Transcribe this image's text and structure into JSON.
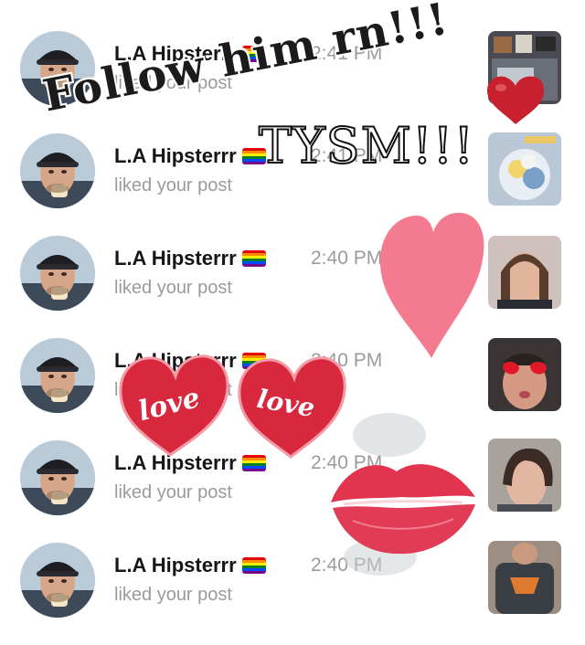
{
  "notifications": [
    {
      "user": "L.A Hipsterrr",
      "time": "2:41 PM",
      "action": "liked your post"
    },
    {
      "user": "L.A Hipsterrr",
      "time": "2:41 PM",
      "action": "liked your post"
    },
    {
      "user": "L.A Hipsterrr",
      "time": "2:40 PM",
      "action": "liked your post"
    },
    {
      "user": "L.A Hipsterrr",
      "time": "2:40 PM",
      "action": "liked your post"
    },
    {
      "user": "L.A Hipsterrr",
      "time": "2:40 PM",
      "action": "liked your post"
    },
    {
      "user": "L.A Hipsterrr",
      "time": "2:40 PM",
      "action": "liked your post"
    }
  ],
  "overlay": {
    "follow_text": "Follow him rn!!!",
    "tysm_text": "TYSM!!!",
    "love_left": "love",
    "love_right": "love"
  },
  "colors": {
    "heart_red": "#d8283e",
    "heart_pink": "#f47a90",
    "text_gray": "#9a9a9a"
  },
  "icons": [
    "rainbow-flag-icon",
    "heart-sticker",
    "lips-sticker"
  ]
}
